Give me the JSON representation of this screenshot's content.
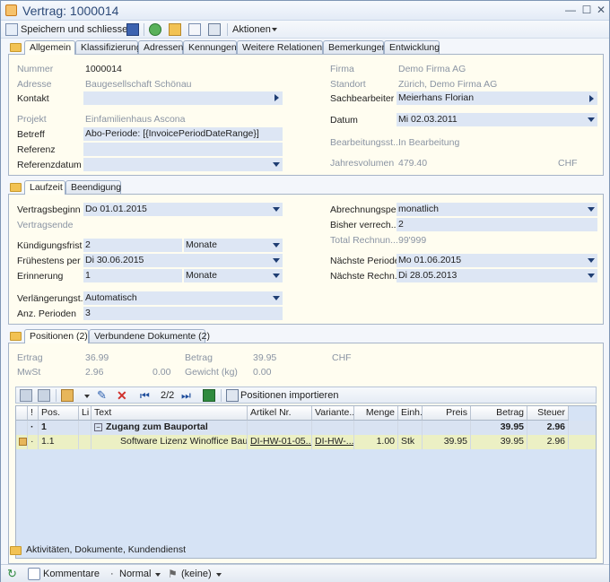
{
  "window": {
    "title": "Vertrag: 1000014"
  },
  "toolbar": {
    "save_close": "Speichern und schliessen",
    "actions": "Aktionen"
  },
  "tabs_main": [
    "Allgemein",
    "Klassifizierung",
    "Adressen",
    "Kennungen",
    "Weitere Relationen",
    "Bemerkungen",
    "Entwicklung"
  ],
  "general": {
    "nummer_label": "Nummer",
    "nummer": "1000014",
    "adresse_label": "Adresse",
    "adresse": "Baugesellschaft Schönau",
    "kontakt_label": "Kontakt",
    "projekt_label": "Projekt",
    "projekt": "Einfamilienhaus Ascona",
    "betreff_label": "Betreff",
    "betreff": "Abo-Periode: [{InvoicePeriodDateRange}]",
    "referenz_label": "Referenz",
    "referenzdatum_label": "Referenzdatum",
    "firma_label": "Firma",
    "firma": "Demo Firma AG",
    "standort_label": "Standort",
    "standort": "Zürich, Demo Firma AG",
    "sachbearbeiter_label": "Sachbearbeiter",
    "sachbearbeiter": "Meierhans Florian",
    "datum_label": "Datum",
    "datum": "Mi 02.03.2011",
    "bearbeitung_label": "Bearbeitungsst...",
    "bearbeitung": "In Bearbeitung",
    "jahresvolumen_label": "Jahresvolumen",
    "jahresvolumen": "479.40",
    "currency": "CHF"
  },
  "tabs_term": [
    "Laufzeit",
    "Beendigung"
  ],
  "term": {
    "beginn_label": "Vertragsbeginn",
    "beginn": "Do 01.01.2015",
    "ende_label": "Vertragsende",
    "kuendigung_label": "Kündigungsfrist",
    "kuendigung": "2",
    "kuendigung_unit": "Monate",
    "fruehestens_label": "Frühestens per",
    "fruehestens": "Di 30.06.2015",
    "erinnerung_label": "Erinnerung",
    "erinnerung": "1",
    "erinnerung_unit": "Monate",
    "verlaengerung_label": "Verlängerungst...",
    "verlaengerung": "Automatisch",
    "anz_label": "Anz. Perioden",
    "anz": "3",
    "abrechnung_label": "Abrechnungspe...",
    "abrechnung": "monatlich",
    "bisher_label": "Bisher verrech...",
    "bisher": "2",
    "total_label": "Total Rechnun...",
    "total": "99'999",
    "naechste_label": "Nächste Periode",
    "naechste": "Mo 01.06.2015",
    "naechste_r_label": "Nächste Rechn...",
    "naechste_r": "Di 28.05.2013"
  },
  "tabs_pos": [
    "Positionen (2)",
    "Verbundene Dokumente (2)"
  ],
  "summary": {
    "ertrag_label": "Ertrag",
    "ertrag": "36.99",
    "betrag_label": "Betrag",
    "betrag": "39.95",
    "currency": "CHF",
    "mwst_label": "MwSt",
    "mwst": "2.96",
    "mwst2": "0.00",
    "gewicht_label": "Gewicht (kg)",
    "gewicht": "0.00"
  },
  "grid_toolbar": {
    "page": "2/2",
    "import": "Positionen importieren"
  },
  "grid": {
    "headers": [
      "",
      "!",
      "Pos.",
      "Li",
      "Text",
      "Artikel Nr.",
      "Variante...",
      "Menge",
      "Einh.",
      "Preis",
      "Betrag",
      "Steuer"
    ],
    "rows": [
      [
        "",
        "·",
        "1",
        "",
        "Zugang zum Bauportal",
        "",
        "",
        "",
        "",
        "",
        "39.95",
        "2.96"
      ],
      [
        "",
        "·",
        "1.1",
        "",
        "Software Lizenz Winoffice Bau...",
        "DI-HW-01-05...",
        "DI-HW-...",
        "1.00",
        "Stk",
        "39.95",
        "39.95",
        "2.96"
      ]
    ]
  },
  "footer": {
    "text": "Aktivitäten, Dokumente, Kundendienst"
  },
  "status": {
    "kommentare": "Kommentare",
    "priority": "Normal",
    "flag": "(keine)"
  }
}
